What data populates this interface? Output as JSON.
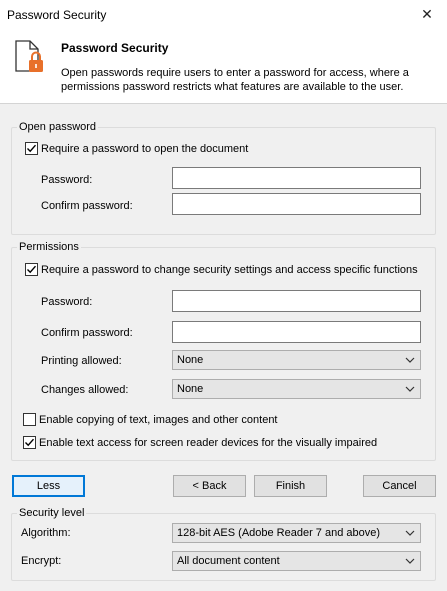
{
  "window": {
    "title": "Password Security",
    "close": "✕"
  },
  "header": {
    "title": "Password Security",
    "description": "Open passwords require users to enter a password for access, where a permissions password restricts what features are available to the user."
  },
  "open_password": {
    "group_title": "Open password",
    "require_label": "Require a password to open the document",
    "require_checked": true,
    "password_label": "Password:",
    "password_value": "",
    "confirm_label": "Confirm password:",
    "confirm_value": ""
  },
  "permissions": {
    "group_title": "Permissions",
    "require_label": "Require a password to change security settings and access specific functions",
    "require_checked": true,
    "password_label": "Password:",
    "password_value": "",
    "confirm_label": "Confirm password:",
    "confirm_value": "",
    "printing_label": "Printing allowed:",
    "printing_value": "None",
    "changes_label": "Changes allowed:",
    "changes_value": "None",
    "copy_label": "Enable copying of text, images and other content",
    "copy_checked": false,
    "screen_reader_label": "Enable text access for screen reader devices for the visually impaired",
    "screen_reader_checked": true
  },
  "buttons": {
    "less": "Less",
    "back": "< Back",
    "finish": "Finish",
    "cancel": "Cancel"
  },
  "security_level": {
    "group_title": "Security level",
    "algorithm_label": "Algorithm:",
    "algorithm_value": "128-bit AES (Adobe Reader 7 and above)",
    "encrypt_label": "Encrypt:",
    "encrypt_value": "All document content"
  },
  "colors": {
    "accent": "#0078d7",
    "lock": "#e8702a"
  },
  "icons": {
    "document_lock": "document-lock-icon",
    "checkmark": "checkmark-icon",
    "dropdown": "chevron-down-icon"
  }
}
